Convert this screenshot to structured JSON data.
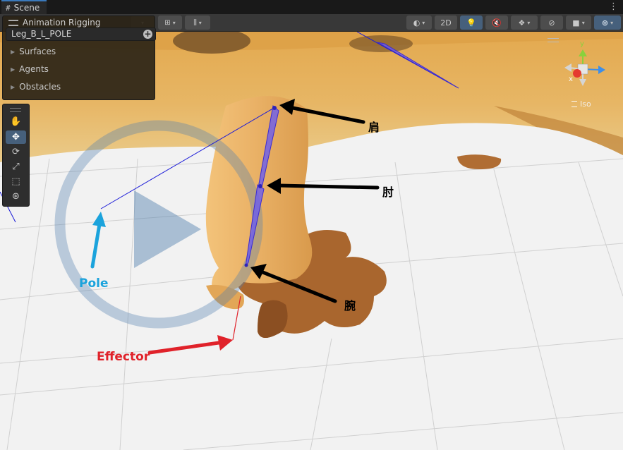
{
  "tab": {
    "title": "Scene",
    "icon": "grid-icon",
    "menu_icon": "kebab-menu-icon"
  },
  "toolbar": {
    "buttons": [
      {
        "name": "shading-mode",
        "icon": "shading-sphere-icon"
      },
      {
        "name": "2d-toggle",
        "label": "2D"
      },
      {
        "name": "lighting-toggle",
        "icon": "lightbulb-icon"
      },
      {
        "name": "audio-toggle",
        "icon": "speaker-icon"
      },
      {
        "name": "effects-toggle",
        "icon": "effects-icon"
      },
      {
        "name": "hidden-objects",
        "icon": "eye-slash-icon"
      },
      {
        "name": "camera-settings",
        "icon": "camera-icon"
      },
      {
        "name": "gizmos",
        "icon": "gizmo-sphere-icon"
      }
    ]
  },
  "overlay": {
    "title": "Animation Rigging",
    "object_field": "Leg_B_L_POLE",
    "items": [
      "Surfaces",
      "Agents",
      "Obstacles"
    ]
  },
  "tools": [
    "view-tool",
    "move-tool",
    "rotate-tool",
    "scale-tool",
    "rect-tool",
    "transform-tool"
  ],
  "gizmo": {
    "y": "y",
    "x": "x",
    "iso": "Iso"
  },
  "annotations": {
    "shoulder": "肩",
    "elbow": "肘",
    "wrist": "腕",
    "pole": "Pole",
    "effector": "Effector"
  },
  "colors": {
    "pole": "#1ba3dc",
    "effector": "#e0222a",
    "bone": "#6a5cf0",
    "fur": "#e9b568",
    "paw": "#a9662e",
    "accent": "#3a79bb"
  }
}
